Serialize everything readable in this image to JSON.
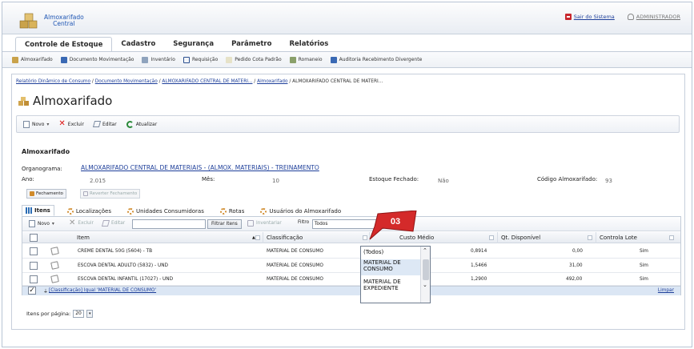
{
  "header": {
    "app_name_line1": "Almoxarifado",
    "app_name_line2": "Central",
    "logout_label": "Sair do Sistema",
    "user_label": "ADMINISTRADOR"
  },
  "main_menu": [
    {
      "label": "Controle de Estoque",
      "active": true
    },
    {
      "label": "Cadastro",
      "active": false
    },
    {
      "label": "Segurança",
      "active": false
    },
    {
      "label": "Parâmetro",
      "active": false
    },
    {
      "label": "Relatórios",
      "active": false
    }
  ],
  "submenu": [
    {
      "label": "Almoxarifado",
      "icon": "warehouse-icon"
    },
    {
      "label": "Documento Movimentação",
      "icon": "document-icon"
    },
    {
      "label": "Inventário",
      "icon": "inventory-icon"
    },
    {
      "label": "Requisição",
      "icon": "requisition-icon"
    },
    {
      "label": "Pedido Cota Padrão",
      "icon": "order-icon"
    },
    {
      "label": "Romaneio",
      "icon": "romaneio-icon"
    },
    {
      "label": "Auditoria Recebimento Divergente",
      "icon": "audit-icon"
    }
  ],
  "breadcrumb": {
    "items": [
      "Relatório Dinâmico de Consumo",
      "Documento Movimentação",
      "ALMOXARIFADO CENTRAL DE MATERI...",
      "Almoxarifado"
    ],
    "current": "ALMOXARIFADO CENTRAL DE MATERI...",
    "separator": " / "
  },
  "page_title": "Almoxarifado",
  "toolbar": {
    "new": "Novo",
    "delete": "Excluir",
    "edit": "Editar",
    "refresh": "Atualizar"
  },
  "details": {
    "section_title": "Almoxarifado",
    "org_label": "Organograma:",
    "org_value": "ALMOXARIFADO CENTRAL DE MATERIAIS - (ALMOX. MATERIAIS) - TREINAMENTO",
    "year_label": "Ano:",
    "year_value": "2.015",
    "month_label": "Mês:",
    "month_value": "10",
    "stock_closed_label": "Estoque Fechado:",
    "stock_closed_value": "Não",
    "code_label": "Código Almoxarifado:",
    "code_value": "93",
    "close_button": "Fechamento",
    "revert_button": "Reverter Fechamento"
  },
  "tabs": [
    {
      "label": "Itens",
      "active": true
    },
    {
      "label": "Localizações",
      "active": false
    },
    {
      "label": "Unidades Consumidoras",
      "active": false
    },
    {
      "label": "Rotas",
      "active": false
    },
    {
      "label": "Usuários do Almoxarifado",
      "active": false
    }
  ],
  "grid_toolbar": {
    "new": "Novo",
    "delete": "Excluir",
    "edit": "Editar",
    "search_value": "",
    "filter_button": "Filtrar Itens",
    "inventory": "Inventariar",
    "filter_label": "Filtro",
    "filter_value": "Todos"
  },
  "table": {
    "columns": [
      "Item",
      "Classificação",
      "Custo Médio",
      "Qt. Disponível",
      "Controla Lote"
    ],
    "rows": [
      {
        "item": "CREME DENTAL 50G (5604) - TB",
        "classificacao": "MATERIAL DE CONSUMO",
        "custo": "0,8914",
        "qt": "0,00",
        "lote": "Sim"
      },
      {
        "item": "ESCOVA DENTAL ADULTO (5832) - UND",
        "classificacao": "MATERIAL DE CONSUMO",
        "custo": "1,5466",
        "qt": "31,00",
        "lote": "Sim"
      },
      {
        "item": "ESCOVA DENTAL INFANTIL (17027) - UND",
        "classificacao": "MATERIAL DE CONSUMO",
        "custo": "1,2900",
        "qt": "492,00",
        "lote": "Sim"
      }
    ],
    "filter_text": "[Classificação] Igual 'MATERIAL DE CONSUMO'",
    "clear_label": "Limpar"
  },
  "pager": {
    "label": "Itens por página:",
    "value": "20"
  },
  "dropdown": {
    "options": [
      "(Todos)",
      "MATERIAL DE CONSUMO",
      "MATERIAL DE EXPEDIENTE"
    ]
  },
  "callout": {
    "number": "03"
  },
  "colors": {
    "accent": "#1e3f9a",
    "callout": "#d42a2a",
    "selected_row": "#dbe6f4"
  }
}
